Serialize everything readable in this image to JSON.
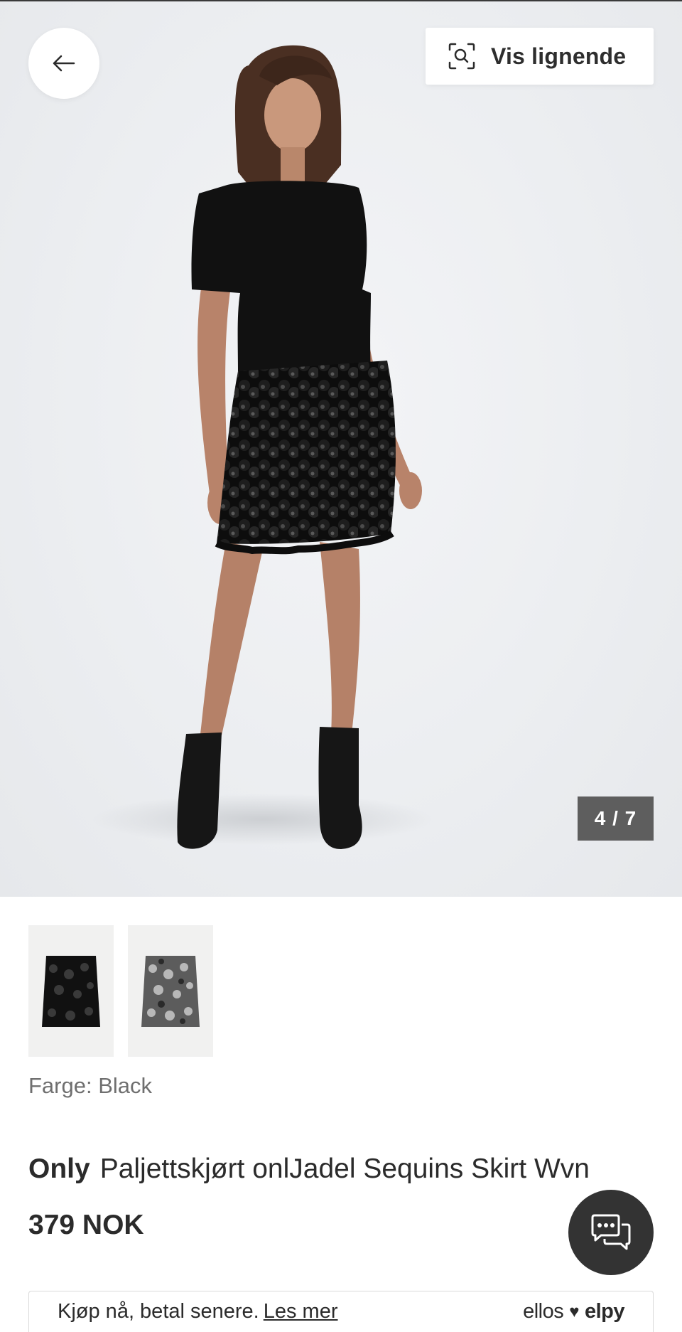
{
  "gallery": {
    "similar_label": "Vis lignende",
    "counter": "4 / 7",
    "image_alt": "model-wearing-black-sequin-skirt"
  },
  "variants": [
    {
      "name": "Black",
      "color": "#111111"
    },
    {
      "name": "Silver",
      "color": "#8a8a8a"
    }
  ],
  "product": {
    "color_line": "Farge: Black",
    "brand": "Only",
    "name": "Paljettskjørt onlJadel Sequins Skirt Wvn",
    "price": "379 NOK"
  },
  "payment": {
    "text": "Kjøp nå, betal senere.",
    "link": "Les mer",
    "logo_left": "ellos",
    "logo_right": "elpy"
  },
  "icons": {
    "back": "arrow-left-icon",
    "similar": "visual-search-icon",
    "chat": "chat-bubbles-icon",
    "heart": "heart-icon"
  },
  "colors": {
    "hero_bg": "#eceef1",
    "dark": "#2b2b2b",
    "counter_bg": "#5e5e5e",
    "chat_bg": "#333333"
  }
}
